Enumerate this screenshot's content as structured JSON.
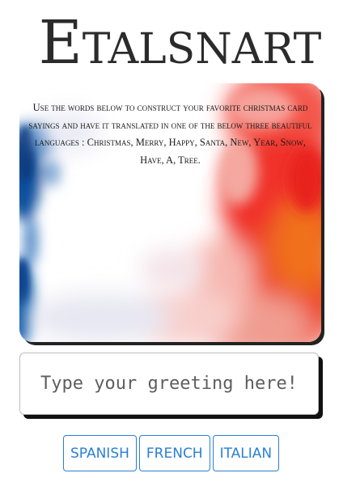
{
  "header": {
    "title": "Etalsnart"
  },
  "card": {
    "instructions": "Use the words below to construct your favorite christmas card sayings and have it translated in one of the below three beautiful languages : Christmas, Merry, Happy, Santa, New, Year, Snow, Have, A, Tree."
  },
  "greeting_input": {
    "placeholder": "Type your greeting here!",
    "value": ""
  },
  "language_buttons": {
    "spanish": "SPANISH",
    "french": "FRENCH",
    "italian": "ITALIAN"
  },
  "colors": {
    "title": "#2b2b2b",
    "button_accent": "#2a7fd4",
    "watercolor_blue": "#0d4f9e",
    "watercolor_red": "#f0302a",
    "watercolor_orange": "#f0701e",
    "shadow": "#111111"
  }
}
